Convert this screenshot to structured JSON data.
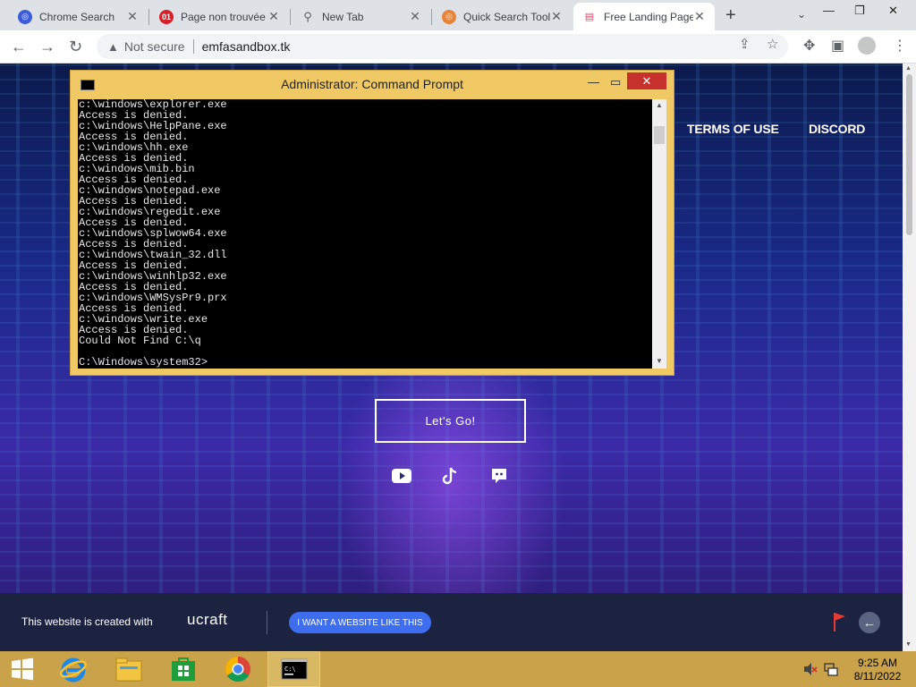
{
  "browser": {
    "tabs": [
      {
        "title": "Chrome Search",
        "active": false
      },
      {
        "title": "Page non trouvée",
        "active": false
      },
      {
        "title": "New Tab",
        "active": false
      },
      {
        "title": "Quick Search Tool",
        "active": false
      },
      {
        "title": "Free Landing Page",
        "active": true
      }
    ],
    "new_tab_icon": "+",
    "security_label": "Not secure",
    "url": "emfasandbox.tk"
  },
  "site": {
    "nav": [
      "TERMS OF USE",
      "DISCORD"
    ],
    "cta_label": "Let's Go!",
    "social_icons": [
      "youtube-icon",
      "tiktok-icon",
      "discord-icon"
    ],
    "footer": {
      "made_with": "This website is created with",
      "brand": "ucraft",
      "button": "I WANT A WEBSITE LIKE THIS"
    }
  },
  "cmd": {
    "title": "Administrator: Command Prompt",
    "lines": [
      "c:\\windows\\explorer.exe",
      "Access is denied.",
      "c:\\windows\\HelpPane.exe",
      "Access is denied.",
      "c:\\windows\\hh.exe",
      "Access is denied.",
      "c:\\windows\\mib.bin",
      "Access is denied.",
      "c:\\windows\\notepad.exe",
      "Access is denied.",
      "c:\\windows\\regedit.exe",
      "Access is denied.",
      "c:\\windows\\splwow64.exe",
      "Access is denied.",
      "c:\\windows\\twain_32.dll",
      "Access is denied.",
      "c:\\windows\\winhlp32.exe",
      "Access is denied.",
      "c:\\windows\\WMSysPr9.prx",
      "Access is denied.",
      "c:\\windows\\write.exe",
      "Access is denied.",
      "Could Not Find C:\\q",
      "",
      "C:\\Windows\\system32>"
    ]
  },
  "taskbar": {
    "items": [
      "ie-icon",
      "file-explorer-icon",
      "store-icon",
      "chrome-icon",
      "cmd-icon"
    ],
    "time": "9:25 AM",
    "date": "8/11/2022"
  },
  "colors": {
    "taskbar": "#c9a24a",
    "cmd_frame": "#f0c965",
    "close_button": "#c7312d",
    "footer_button": "#3d6ef0"
  }
}
